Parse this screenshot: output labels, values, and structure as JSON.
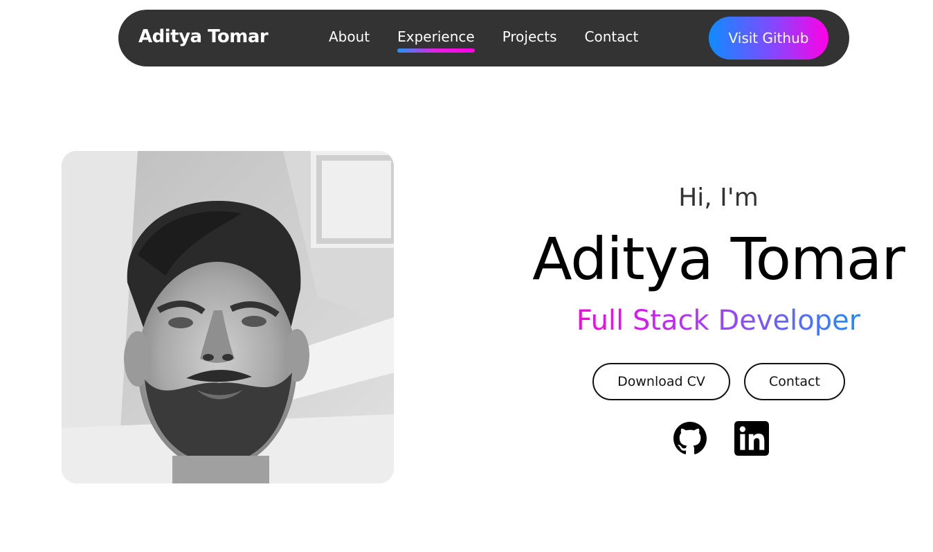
{
  "navbar": {
    "brand": "Aditya Tomar",
    "links": [
      {
        "label": "About",
        "active": false
      },
      {
        "label": "Experience",
        "active": true
      },
      {
        "label": "Projects",
        "active": false
      },
      {
        "label": "Contact",
        "active": false
      }
    ],
    "cta_label": "Visit Github"
  },
  "hero": {
    "greeting": "Hi, I'm",
    "name": "Aditya Tomar",
    "role": "Full Stack Developer",
    "buttons": {
      "cv_label": "Download CV",
      "contact_label": "Contact"
    },
    "socials": [
      {
        "icon": "github-icon"
      },
      {
        "icon": "linkedin-icon"
      }
    ]
  },
  "profile_photo": {
    "style": "grayscale",
    "icon": "profile-photo"
  },
  "colors": {
    "navbar_bg": "#333333",
    "gradient_blue": "#1d8bff",
    "gradient_magenta": "#ff00e6",
    "text_dark": "#000000"
  }
}
